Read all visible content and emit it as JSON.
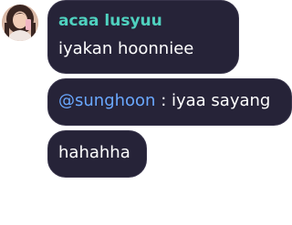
{
  "messages": [
    {
      "sender": "acaa lusyuu",
      "text": "iyakan hoonniee"
    },
    {
      "mention": "@sunghoon",
      "text": " : iyaa sayang"
    },
    {
      "text": "hahahha"
    }
  ],
  "colors": {
    "bubble_bg": "#262338",
    "sender_name": "#4fd1bf",
    "mention": "#6aa8ff",
    "message_text": "#ffffff"
  },
  "icons": {
    "avatar": "user-avatar-photo"
  }
}
